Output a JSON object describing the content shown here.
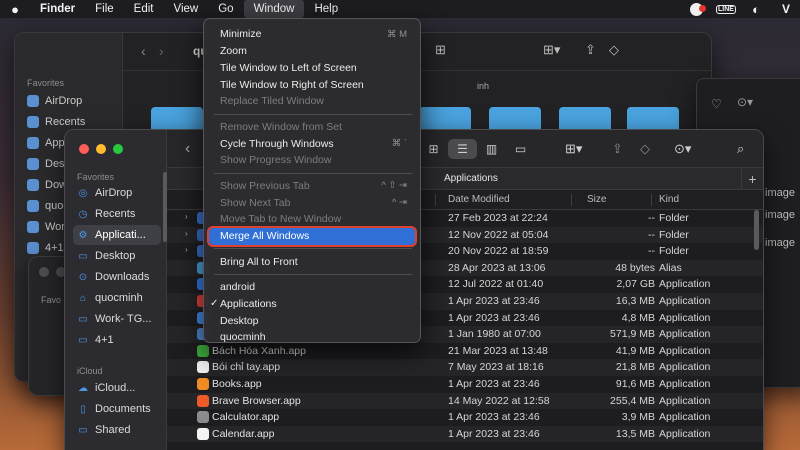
{
  "menubar": {
    "app": "Finder",
    "menus": [
      "File",
      "Edit",
      "View",
      "Go",
      "Window",
      "Help"
    ],
    "active_menu": "Window",
    "status_icons": [
      "notification-icon",
      "line-icon",
      "ultraviewer-icon",
      "vpn-icon"
    ],
    "line_label": "LINE",
    "v_label": "V"
  },
  "back_window": {
    "sidebar_title": "Favorites",
    "items": [
      "AirDrop",
      "Recents",
      "Appl",
      "Desk",
      "Dow",
      "quoc",
      "Work",
      "4+1"
    ],
    "path_fragment": "qu",
    "tab_fragment": "inh"
  },
  "back2_window": {
    "sidebar_title": "Favo"
  },
  "right_window": {
    "rows": [
      "image",
      "image",
      "image"
    ]
  },
  "finder": {
    "sidebar": {
      "favorites_title": "Favorites",
      "favorites": [
        {
          "label": "AirDrop",
          "icon": "airdrop-icon",
          "glyph": "◎"
        },
        {
          "label": "Recents",
          "icon": "recents-icon",
          "glyph": "◷"
        },
        {
          "label": "Applicati...",
          "icon": "applications-icon",
          "glyph": "⚙"
        },
        {
          "label": "Desktop",
          "icon": "desktop-icon",
          "glyph": "▭"
        },
        {
          "label": "Downloads",
          "icon": "downloads-icon",
          "glyph": "⊙"
        },
        {
          "label": "quocminh",
          "icon": "home-icon",
          "glyph": "⌂"
        },
        {
          "label": "Work- TG...",
          "icon": "folder-icon",
          "glyph": "▭"
        },
        {
          "label": "4+1",
          "icon": "folder-icon",
          "glyph": "▭"
        }
      ],
      "icloud_title": "iCloud",
      "icloud": [
        {
          "label": "iCloud...",
          "icon": "icloud-icon",
          "glyph": "☁"
        },
        {
          "label": "Documents",
          "icon": "documents-icon",
          "glyph": "▯"
        },
        {
          "label": "Shared",
          "icon": "shared-icon",
          "glyph": "▭"
        }
      ]
    },
    "tab_title": "Applications",
    "columns": {
      "date": "Date Modified",
      "size": "Size",
      "kind": "Kind"
    },
    "rows": [
      {
        "name": "",
        "date": "27 Feb 2023 at 22:24",
        "size": "--",
        "kind": "Folder",
        "color": "#3a6fd0",
        "disclosure": true
      },
      {
        "name": "",
        "date": "12 Nov 2022 at 05:04",
        "size": "--",
        "kind": "Folder",
        "color": "#3a6fd0",
        "disclosure": true
      },
      {
        "name": "",
        "date": "20 Nov 2022 at 18:59",
        "size": "--",
        "kind": "Folder",
        "color": "#3a6fd0",
        "disclosure": true
      },
      {
        "name": "",
        "date": "28 Apr 2023 at 13:06",
        "size": "48 bytes",
        "kind": "Alias",
        "color": "#4aa3df",
        "disclosure": false
      },
      {
        "name": "",
        "date": "12 Jul 2022 at 01:40",
        "size": "2,07 GB",
        "kind": "Application",
        "color": "#2f7be8",
        "disclosure": false
      },
      {
        "name": "",
        "date": "1 Apr 2023 at 23:46",
        "size": "16,3 MB",
        "kind": "Application",
        "color": "#e8413a",
        "disclosure": false
      },
      {
        "name": "",
        "date": "1 Apr 2023 at 23:46",
        "size": "4,8 MB",
        "kind": "Application",
        "color": "#3f8ef0",
        "disclosure": false
      },
      {
        "name": "",
        "date": "1 Jan 1980 at 07:00",
        "size": "571,9 MB",
        "kind": "Application",
        "color": "#4c8ad8",
        "disclosure": false
      },
      {
        "name": "Bách Hóa Xanh.app",
        "date": "21 Mar 2023 at 13:48",
        "size": "41,9 MB",
        "kind": "Application",
        "color": "#3fae3c",
        "disclosure": false
      },
      {
        "name": "Bói chỉ tay.app",
        "date": "7 May 2023 at 18:16",
        "size": "21,8 MB",
        "kind": "Application",
        "color": "#f2f2f2",
        "disclosure": false
      },
      {
        "name": "Books.app",
        "date": "1 Apr 2023 at 23:46",
        "size": "91,6 MB",
        "kind": "Application",
        "color": "#f08a24",
        "disclosure": false
      },
      {
        "name": "Brave Browser.app",
        "date": "14 May 2022 at 12:58",
        "size": "255,4 MB",
        "kind": "Application",
        "color": "#f05a28",
        "disclosure": false
      },
      {
        "name": "Calculator.app",
        "date": "1 Apr 2023 at 23:46",
        "size": "3,9 MB",
        "kind": "Application",
        "color": "#8a8a8e",
        "disclosure": false
      },
      {
        "name": "Calendar.app",
        "date": "1 Apr 2023 at 23:46",
        "size": "13,5 MB",
        "kind": "Application",
        "color": "#f4f4f4",
        "disclosure": false
      }
    ]
  },
  "window_menu": {
    "groups": [
      [
        {
          "label": "Minimize",
          "shortcut": "⌘ M",
          "disabled": false
        },
        {
          "label": "Zoom",
          "shortcut": "",
          "disabled": false
        },
        {
          "label": "Tile Window to Left of Screen",
          "shortcut": "",
          "disabled": false
        },
        {
          "label": "Tile Window to Right of Screen",
          "shortcut": "",
          "disabled": false
        },
        {
          "label": "Replace Tiled Window",
          "shortcut": "",
          "disabled": true
        }
      ],
      [
        {
          "label": "Remove Window from Set",
          "shortcut": "",
          "disabled": true
        },
        {
          "label": "Cycle Through Windows",
          "shortcut": "⌘ `",
          "disabled": false
        },
        {
          "label": "Show Progress Window",
          "shortcut": "",
          "disabled": true
        }
      ],
      [
        {
          "label": "Show Previous Tab",
          "shortcut": "^ ⇧ ⇥",
          "disabled": true
        },
        {
          "label": "Show Next Tab",
          "shortcut": "^ ⇥",
          "disabled": true
        },
        {
          "label": "Move Tab to New Window",
          "shortcut": "",
          "disabled": true
        },
        {
          "label": "Merge All Windows",
          "shortcut": "",
          "disabled": false,
          "highlighted": true
        }
      ],
      [
        {
          "label": "Bring All to Front",
          "shortcut": "",
          "disabled": false
        }
      ],
      [
        {
          "label": "android",
          "shortcut": "",
          "disabled": false
        },
        {
          "label": "Applications",
          "shortcut": "",
          "disabled": false,
          "checked": true
        },
        {
          "label": "Desktop",
          "shortcut": "",
          "disabled": false
        },
        {
          "label": "quocminh",
          "shortcut": "",
          "disabled": false
        }
      ]
    ]
  }
}
